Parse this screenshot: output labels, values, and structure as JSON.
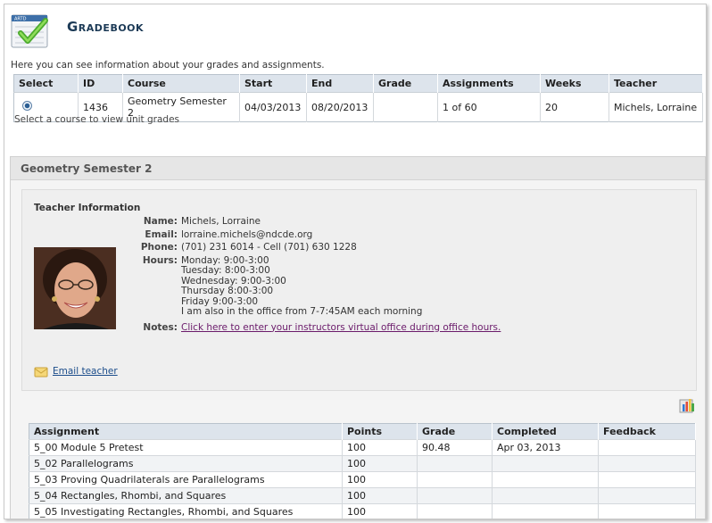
{
  "header": {
    "title": "Gradebook",
    "logo_icon": "gradebook-check-icon",
    "logo_text": "ARTD"
  },
  "intro_text": "Here you can see information about your grades and assignments.",
  "course_table": {
    "columns": [
      "Select",
      "ID",
      "Course",
      "Start",
      "End",
      "Grade",
      "Assignments",
      "Weeks",
      "Teacher"
    ],
    "rows": [
      {
        "selected": true,
        "id": "1436",
        "course": "Geometry Semester 2",
        "start": "04/03/2013",
        "end": "08/20/2013",
        "grade": "",
        "assignments": "1 of 60",
        "weeks": "20",
        "teacher": "Michels, Lorraine"
      }
    ]
  },
  "hint": "Select a course to view unit grades",
  "section": {
    "title": "Geometry Semester 2",
    "teacher_info": {
      "heading": "Teacher Information",
      "name_label": "Name:",
      "name": "Michels, Lorraine",
      "email_label": "Email:",
      "email": "lorraine.michels@ndcde.org",
      "phone_label": "Phone:",
      "phone": "(701) 231 6014 - Cell (701) 630 1228",
      "hours_label": "Hours:",
      "hours": [
        "Monday: 9:00-3:00",
        "Tuesday: 8:00-3:00",
        "Wednesday: 9:00-3:00",
        "Thursday 8:00-3:00",
        "Friday 9:00-3:00",
        "I am also in the office from 7-7:45AM each morning"
      ],
      "notes_label": "Notes:",
      "notes_link": "Click here to enter your instructors virtual office during office hours.",
      "email_teacher": "Email teacher"
    }
  },
  "assignments": {
    "columns": [
      "Assignment",
      "Points",
      "Grade",
      "Completed",
      "Feedback"
    ],
    "rows": [
      {
        "name": "5_00 Module 5 Pretest",
        "points": "100",
        "grade": "90.48",
        "completed": "Apr 03, 2013",
        "feedback": ""
      },
      {
        "name": "5_02 Parallelograms",
        "points": "100",
        "grade": "",
        "completed": "",
        "feedback": ""
      },
      {
        "name": "5_03 Proving Quadrilaterals are Parallelograms",
        "points": "100",
        "grade": "",
        "completed": "",
        "feedback": ""
      },
      {
        "name": "5_04 Rectangles, Rhombi, and Squares",
        "points": "100",
        "grade": "",
        "completed": "",
        "feedback": ""
      },
      {
        "name": "5_05 Investigating Rectangles, Rhombi, and Squares",
        "points": "100",
        "grade": "",
        "completed": "",
        "feedback": ""
      }
    ]
  },
  "colors": {
    "header_bg": "#dde4ec",
    "title": "#1c3a56",
    "link": "#1a4c8a",
    "visited_link": "#6a1a6a"
  }
}
